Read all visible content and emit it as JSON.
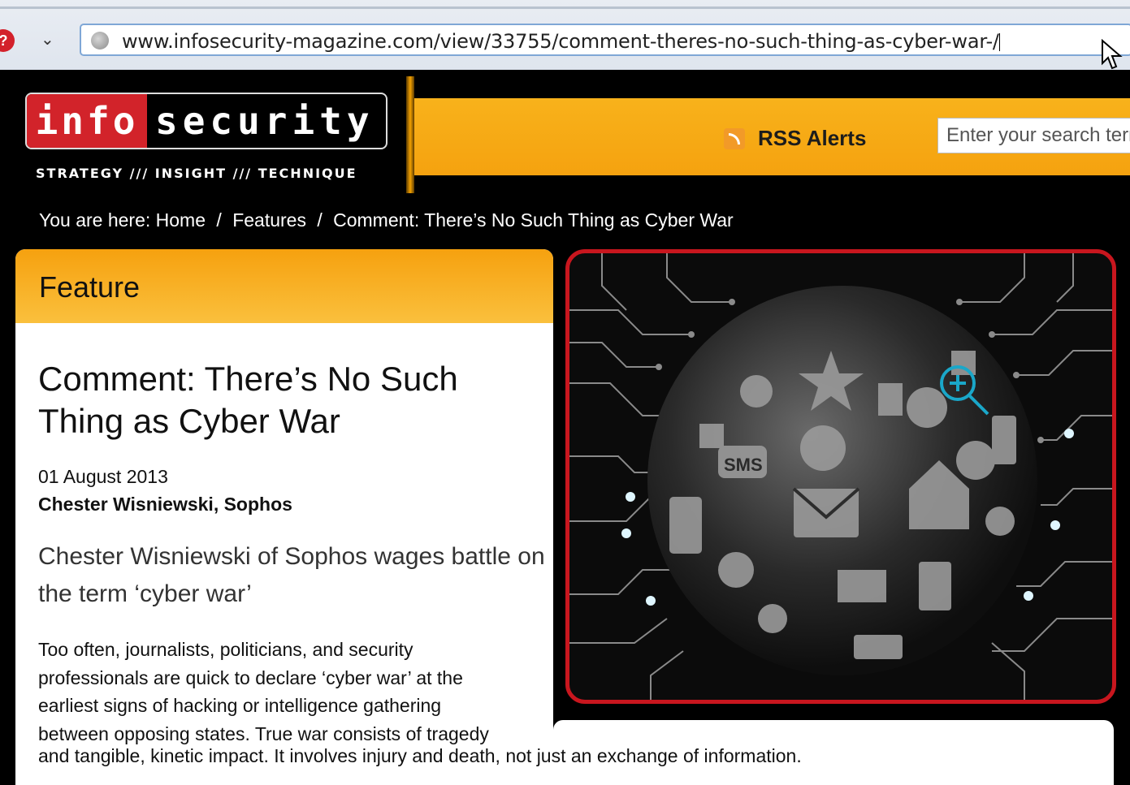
{
  "browser": {
    "url": "www.infosecurity-magazine.com/view/33755/comment-theres-no-such-thing-as-cyber-war-/",
    "history_dropdown": "⌄",
    "ext_icon_glyph": "?"
  },
  "header": {
    "logo_info": "info",
    "logo_security": "security",
    "tagline": "STRATEGY /// INSIGHT /// TECHNIQUE",
    "rss_label": "RSS Alerts",
    "search_placeholder": "Enter your search term"
  },
  "breadcrumb": {
    "prefix": "You are here:",
    "items": [
      "Home",
      "Features",
      "Comment: There’s No Such Thing as Cyber War"
    ],
    "separator": "/"
  },
  "article": {
    "section": "Feature",
    "title": "Comment: There’s No Such Thing as Cyber War",
    "date": "01 August 2013",
    "author": "Chester Wisniewski, Sophos",
    "standfirst": "Chester Wisniewski of Sophos wages battle on the term ‘cyber war’",
    "body_lines": [
      "Too often, journalists, politicians, and security",
      "professionals are quick to declare ‘cyber war’ at the",
      "earliest signs of hacking or intelligence gathering",
      "between opposing states. True war consists of tragedy"
    ],
    "body_last_line": "and tangible, kinetic impact. It involves injury and death, not just an  exchange of information."
  },
  "hero": {
    "image_icon": "globe-of-icons-image",
    "sms_label": "SMS"
  },
  "colors": {
    "brand_red": "#d2232a",
    "brand_orange": "#f5a20f",
    "page_bg": "#000000"
  }
}
